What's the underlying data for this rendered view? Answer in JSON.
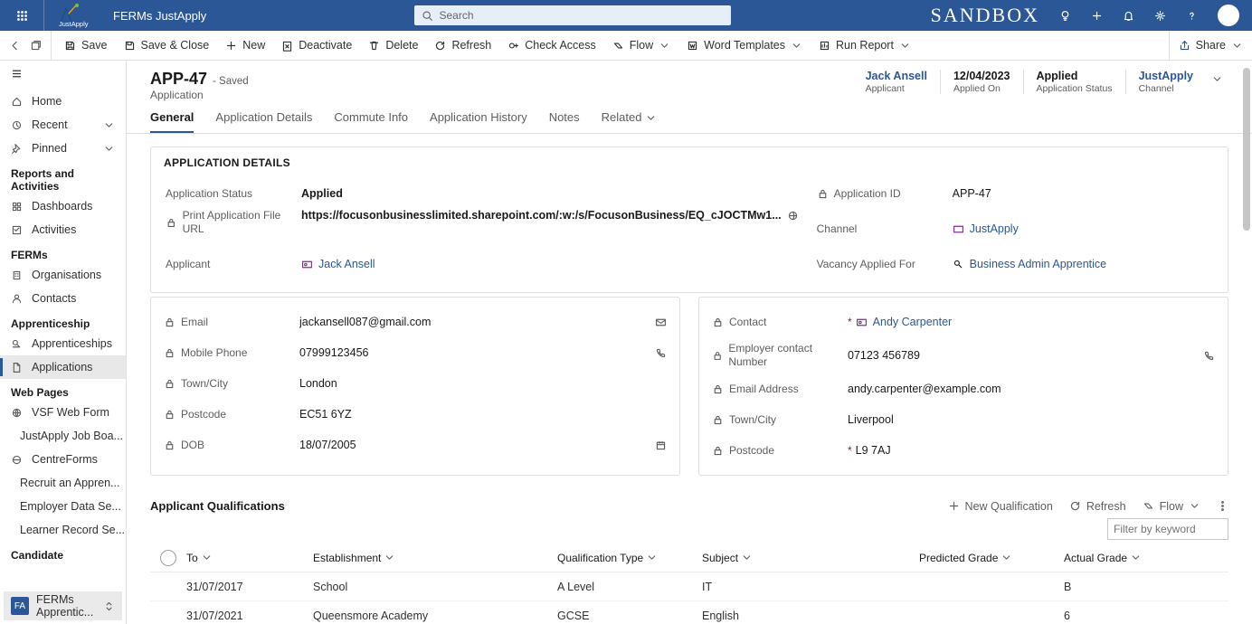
{
  "topbar": {
    "app_name": "FERMs JustApply",
    "search_placeholder": "Search",
    "env_label": "SANDBOX"
  },
  "cmd": {
    "save": "Save",
    "save_close": "Save & Close",
    "new": "New",
    "deactivate": "Deactivate",
    "delete": "Delete",
    "refresh": "Refresh",
    "check_access": "Check Access",
    "flow": "Flow",
    "word_templates": "Word Templates",
    "run_report": "Run Report",
    "share": "Share"
  },
  "nav": {
    "home": "Home",
    "recent": "Recent",
    "pinned": "Pinned",
    "section_reports": "Reports and Activities",
    "dashboards": "Dashboards",
    "activities": "Activities",
    "section_ferms": "FERMs",
    "organisations": "Organisations",
    "contacts": "Contacts",
    "section_app": "Apprenticeship",
    "apprenticeships": "Apprenticeships",
    "applications": "Applications",
    "section_wp": "Web Pages",
    "vsf": "VSF Web Form",
    "job_board": "JustApply Job Boa...",
    "centreforms": "CentreForms",
    "recruit": "Recruit an Appren...",
    "employer_data": "Employer Data Se...",
    "learner_record": "Learner Record Se...",
    "section_candidate": "Candidate",
    "app_picker_badge": "FA",
    "app_picker_label": "FERMs Apprentic..."
  },
  "hdr": {
    "title": "APP-47",
    "state": "- Saved",
    "subtitle": "Application",
    "sum_applicant": "Jack Ansell",
    "sum_applicant_l": "Applicant",
    "sum_applied_on": "12/04/2023",
    "sum_applied_on_l": "Applied On",
    "sum_status": "Applied",
    "sum_status_l": "Application Status",
    "sum_channel": "JustApply",
    "sum_channel_l": "Channel"
  },
  "tabs": {
    "general": "General",
    "app_details": "Application Details",
    "commute": "Commute Info",
    "history": "Application History",
    "notes": "Notes",
    "related": "Related"
  },
  "panel": {
    "title": "APPLICATION DETAILS",
    "status_l": "Application Status",
    "status_v": "Applied",
    "print_l": "Print Application File URL",
    "print_v": "https://focusonbusinesslimited.sharepoint.com/:w:/s/FocusonBusiness/EQ_cJOCTMw1...",
    "applicant_l": "Applicant",
    "applicant_v": "Jack Ansell",
    "appid_l": "Application ID",
    "appid_v": "APP-47",
    "channel_l": "Channel",
    "channel_v": "JustApply",
    "vacancy_l": "Vacancy Applied For",
    "vacancy_v": "Business Admin Apprentice"
  },
  "box1": {
    "email_l": "Email",
    "email_v": "jackansell087@gmail.com",
    "mobile_l": "Mobile Phone",
    "mobile_v": "07999123456",
    "town_l": "Town/City",
    "town_v": "London",
    "post_l": "Postcode",
    "post_v": "EC51 6YZ",
    "dob_l": "DOB",
    "dob_v": "18/07/2005"
  },
  "box2": {
    "contact_l": "Contact",
    "contact_v": "Andy Carpenter",
    "empnum_l": "Employer contact Number",
    "empnum_v": "07123 456789",
    "eaddr_l": "Email Address",
    "eaddr_v": "andy.carpenter@example.com",
    "town_l": "Town/City",
    "town_v": "Liverpool",
    "post_l": "Postcode",
    "post_v": "L9 7AJ"
  },
  "qual": {
    "title": "Applicant Qualifications",
    "new": "New Qualification",
    "refresh": "Refresh",
    "flow": "Flow",
    "filter_ph": "Filter by keyword",
    "th_to": "To",
    "th_est": "Establishment",
    "th_qt": "Qualification Type",
    "th_sub": "Subject",
    "th_pg": "Predicted Grade",
    "th_ag": "Actual Grade",
    "rows": [
      {
        "to": "31/07/2017",
        "est": "School",
        "qt": "A Level",
        "sub": "IT",
        "pg": "",
        "ag": "B"
      },
      {
        "to": "31/07/2021",
        "est": "Queensmore Academy",
        "qt": "GCSE",
        "sub": "English",
        "pg": "",
        "ag": "6"
      }
    ]
  }
}
